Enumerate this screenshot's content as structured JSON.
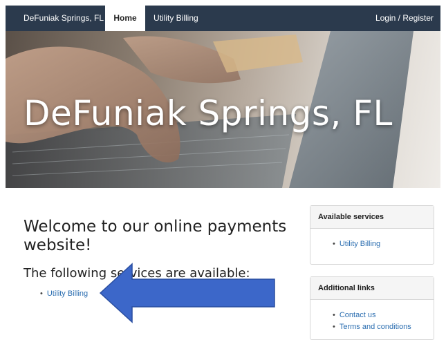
{
  "navbar": {
    "brand": "DeFuniak Springs, FL",
    "home": "Home",
    "utility_billing": "Utility Billing",
    "login": "Login / Register"
  },
  "hero": {
    "title": "DeFuniak Springs, FL"
  },
  "main": {
    "welcome": "Welcome to our online payments website!",
    "services_heading": "The following services are available:",
    "services": [
      "Utility Billing"
    ]
  },
  "sidebar": {
    "available": {
      "title": "Available services",
      "items": [
        "Utility Billing"
      ]
    },
    "additional": {
      "title": "Additional links",
      "items": [
        "Contact us",
        "Terms and conditions"
      ]
    }
  },
  "colors": {
    "navbar_bg": "#2b3a4d",
    "link": "#2a6db0",
    "annotation_arrow": "#3c67c9"
  }
}
